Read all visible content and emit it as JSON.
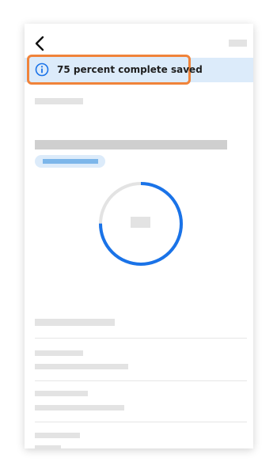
{
  "banner": {
    "icon": "info-icon",
    "message": "75 percent complete saved"
  },
  "progress": {
    "percent": 75
  },
  "colors": {
    "accent": "#1a73e8",
    "banner_bg": "#dcebfa",
    "highlight_border": "#f0833a",
    "ring_track": "#e3e3e3"
  },
  "nav": {
    "back_icon": "chevron-left-icon"
  }
}
